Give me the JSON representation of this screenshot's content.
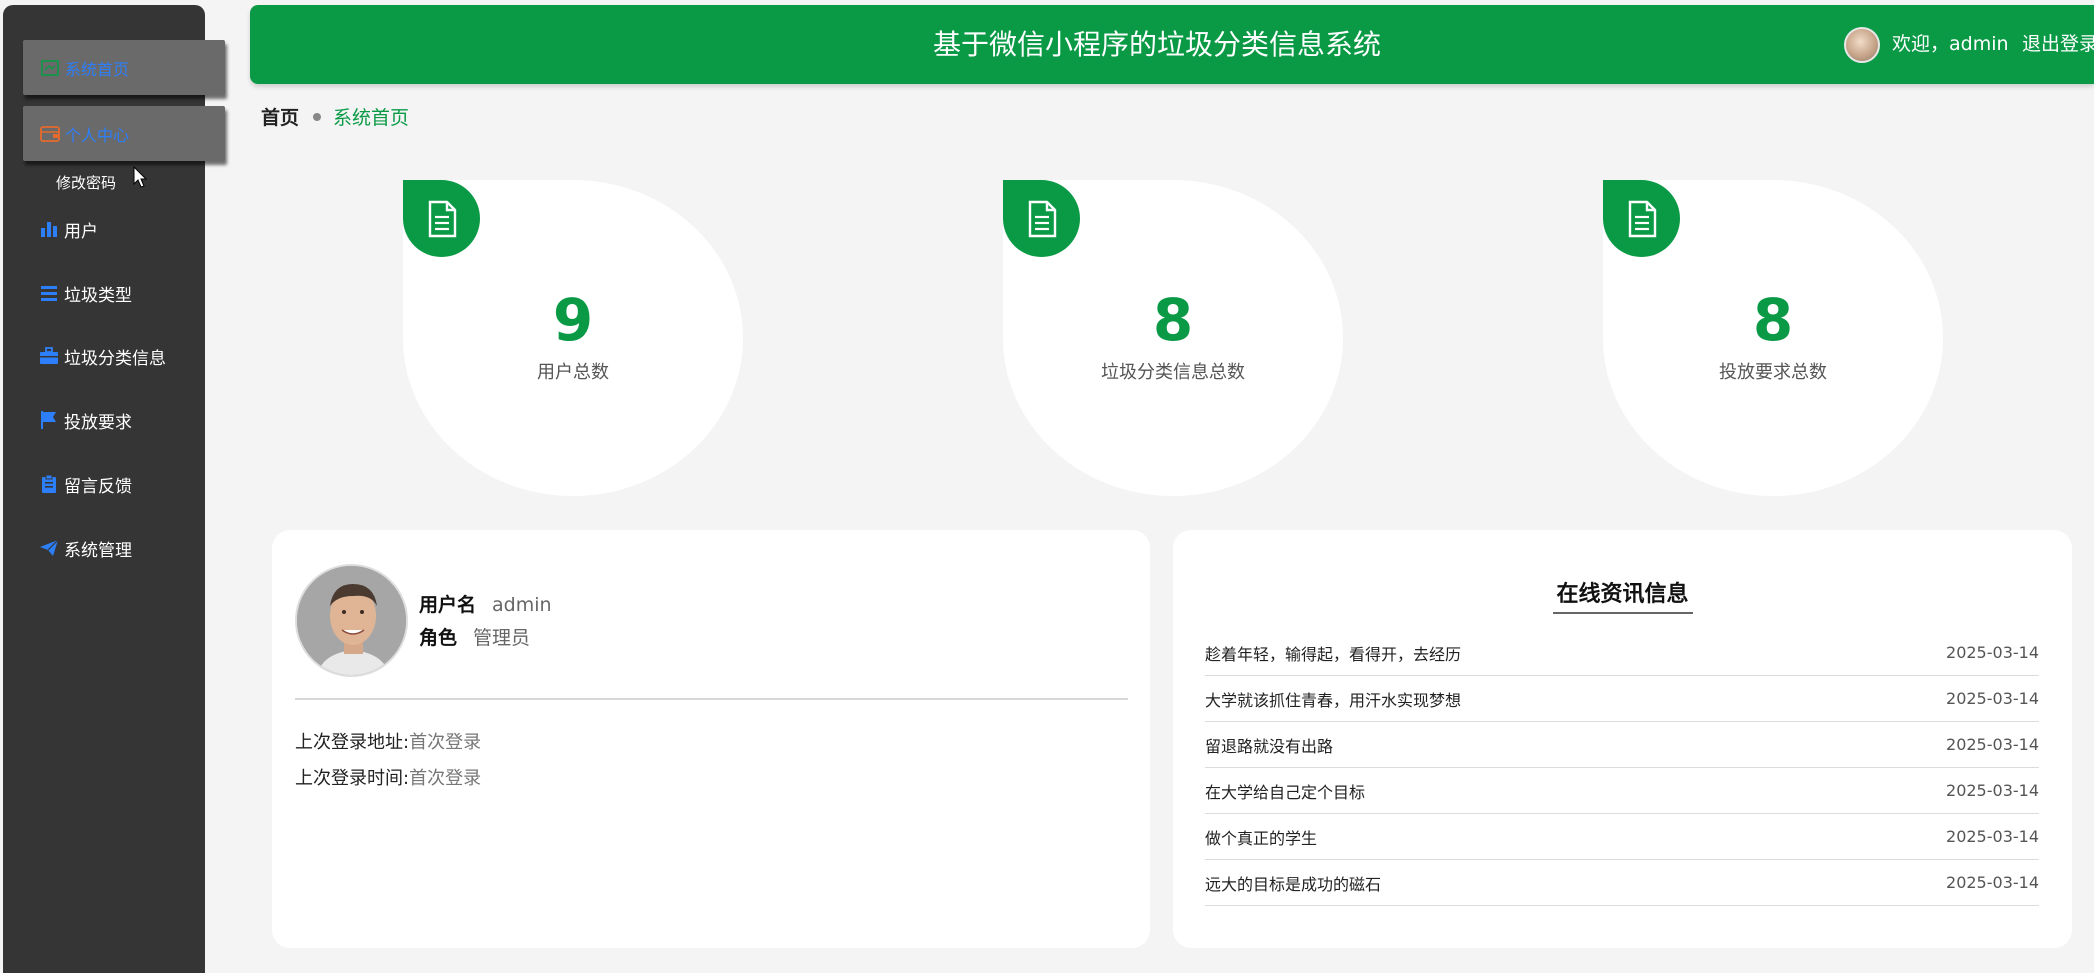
{
  "header": {
    "title": "基于微信小程序的垃圾分类信息系统",
    "welcome": "欢迎，admin",
    "logout": "退出登录"
  },
  "sidebar": {
    "items": [
      {
        "label": "系统首页",
        "icon": "home-icon",
        "color": "#0a9a46"
      },
      {
        "label": "个人中心",
        "icon": "wallet-icon",
        "color": "#e56a2c"
      },
      {
        "label": "用户",
        "icon": "bar-chart-icon",
        "color": "#2d7ff9"
      },
      {
        "label": "垃圾类型",
        "icon": "list-icon",
        "color": "#2d7ff9"
      },
      {
        "label": "垃圾分类信息",
        "icon": "briefcase-icon",
        "color": "#2d7ff9"
      },
      {
        "label": "投放要求",
        "icon": "flag-icon",
        "color": "#2d7ff9"
      },
      {
        "label": "留言反馈",
        "icon": "clipboard-icon",
        "color": "#2d7ff9"
      },
      {
        "label": "系统管理",
        "icon": "paper-plane-icon",
        "color": "#2d7ff9"
      }
    ],
    "sub_item": "修改密码"
  },
  "breadcrumb": {
    "home": "首页",
    "current": "系统首页"
  },
  "stats": [
    {
      "value": "9",
      "label": "用户总数",
      "icon": "document-icon"
    },
    {
      "value": "8",
      "label": "垃圾分类信息总数",
      "icon": "document-icon"
    },
    {
      "value": "8",
      "label": "投放要求总数",
      "icon": "document-icon"
    }
  ],
  "profile": {
    "username_label": "用户名",
    "username": "admin",
    "role_label": "角色",
    "role": "管理员",
    "last_ip_label": "上次登录地址:",
    "last_ip": "首次登录",
    "last_time_label": "上次登录时间:",
    "last_time": "首次登录"
  },
  "news": {
    "title": "在线资讯信息",
    "items": [
      {
        "title": "趁着年轻，输得起，看得开，去经历",
        "date": "2025-03-14"
      },
      {
        "title": "大学就该抓住青春，用汗水实现梦想",
        "date": "2025-03-14"
      },
      {
        "title": "留退路就没有出路",
        "date": "2025-03-14"
      },
      {
        "title": "在大学给自己定个目标",
        "date": "2025-03-14"
      },
      {
        "title": "做个真正的学生",
        "date": "2025-03-14"
      },
      {
        "title": "远大的目标是成功的磁石",
        "date": "2025-03-14"
      }
    ]
  },
  "colors": {
    "primary": "#0a9a46",
    "sidebar_bg": "#353535",
    "accent_blue": "#2d7ff9"
  }
}
